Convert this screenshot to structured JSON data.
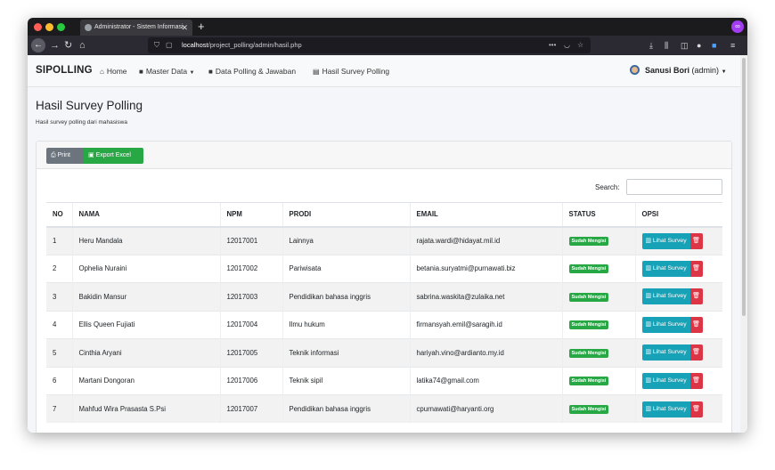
{
  "browser": {
    "tab_title": "Administrator - Sistem Informasi",
    "url_host": "localhost",
    "url_path": "/project_polling/admin/hasil.php"
  },
  "navbar": {
    "brand": "SIPOLLING",
    "links": [
      {
        "icon": "home-icon",
        "label": "Home"
      },
      {
        "icon": "folder-icon",
        "label": "Master Data"
      },
      {
        "icon": "folder-icon",
        "label": "Data Polling & Jawaban"
      },
      {
        "icon": "file-icon",
        "label": "Hasil Survey Polling"
      }
    ],
    "user_name": "Sanusi Bori",
    "user_role": "(admin)"
  },
  "page": {
    "title": "Hasil Survey Polling",
    "subtitle": "Hasil survey polling dari mahasiswa"
  },
  "toolbar": {
    "print_label": "Print",
    "excel_label": "Export Excel"
  },
  "search": {
    "label": "Search:",
    "value": ""
  },
  "table": {
    "headers": [
      "NO",
      "NAMA",
      "NPM",
      "PRODI",
      "EMAIL",
      "STATUS",
      "OPSI"
    ],
    "view_label": "Lihat Survey",
    "rows": [
      {
        "no": "1",
        "nama": "Heru Mandala",
        "npm": "12017001",
        "prodi": "Lainnya",
        "email": "rajata.wardi@hidayat.mil.id",
        "status": "Sudah Mengisi"
      },
      {
        "no": "2",
        "nama": "Ophelia Nuraini",
        "npm": "12017002",
        "prodi": "Pariwisata",
        "email": "betania.suryatmi@purnawati.biz",
        "status": "Sudah Mengisi"
      },
      {
        "no": "3",
        "nama": "Bakidin Mansur",
        "npm": "12017003",
        "prodi": "Pendidikan bahasa inggris",
        "email": "sabrina.waskita@zulaika.net",
        "status": "Sudah Mengisi"
      },
      {
        "no": "4",
        "nama": "Ellis Queen Fujiati",
        "npm": "12017004",
        "prodi": "Ilmu hukum",
        "email": "firmansyah.emil@saragih.id",
        "status": "Sudah Mengisi"
      },
      {
        "no": "5",
        "nama": "Cinthia Aryani",
        "npm": "12017005",
        "prodi": "Teknik informasi",
        "email": "hariyah.vino@ardianto.my.id",
        "status": "Sudah Mengisi"
      },
      {
        "no": "6",
        "nama": "Martani Dongoran",
        "npm": "12017006",
        "prodi": "Teknik sipil",
        "email": "latika74@gmail.com",
        "status": "Sudah Mengisi"
      },
      {
        "no": "7",
        "nama": "Mahfud Wira Prasasta S.Psi",
        "npm": "12017007",
        "prodi": "Pendidikan bahasa inggris",
        "email": "cpurnawati@haryanti.org",
        "status": "Sudah Mengisi"
      }
    ]
  }
}
